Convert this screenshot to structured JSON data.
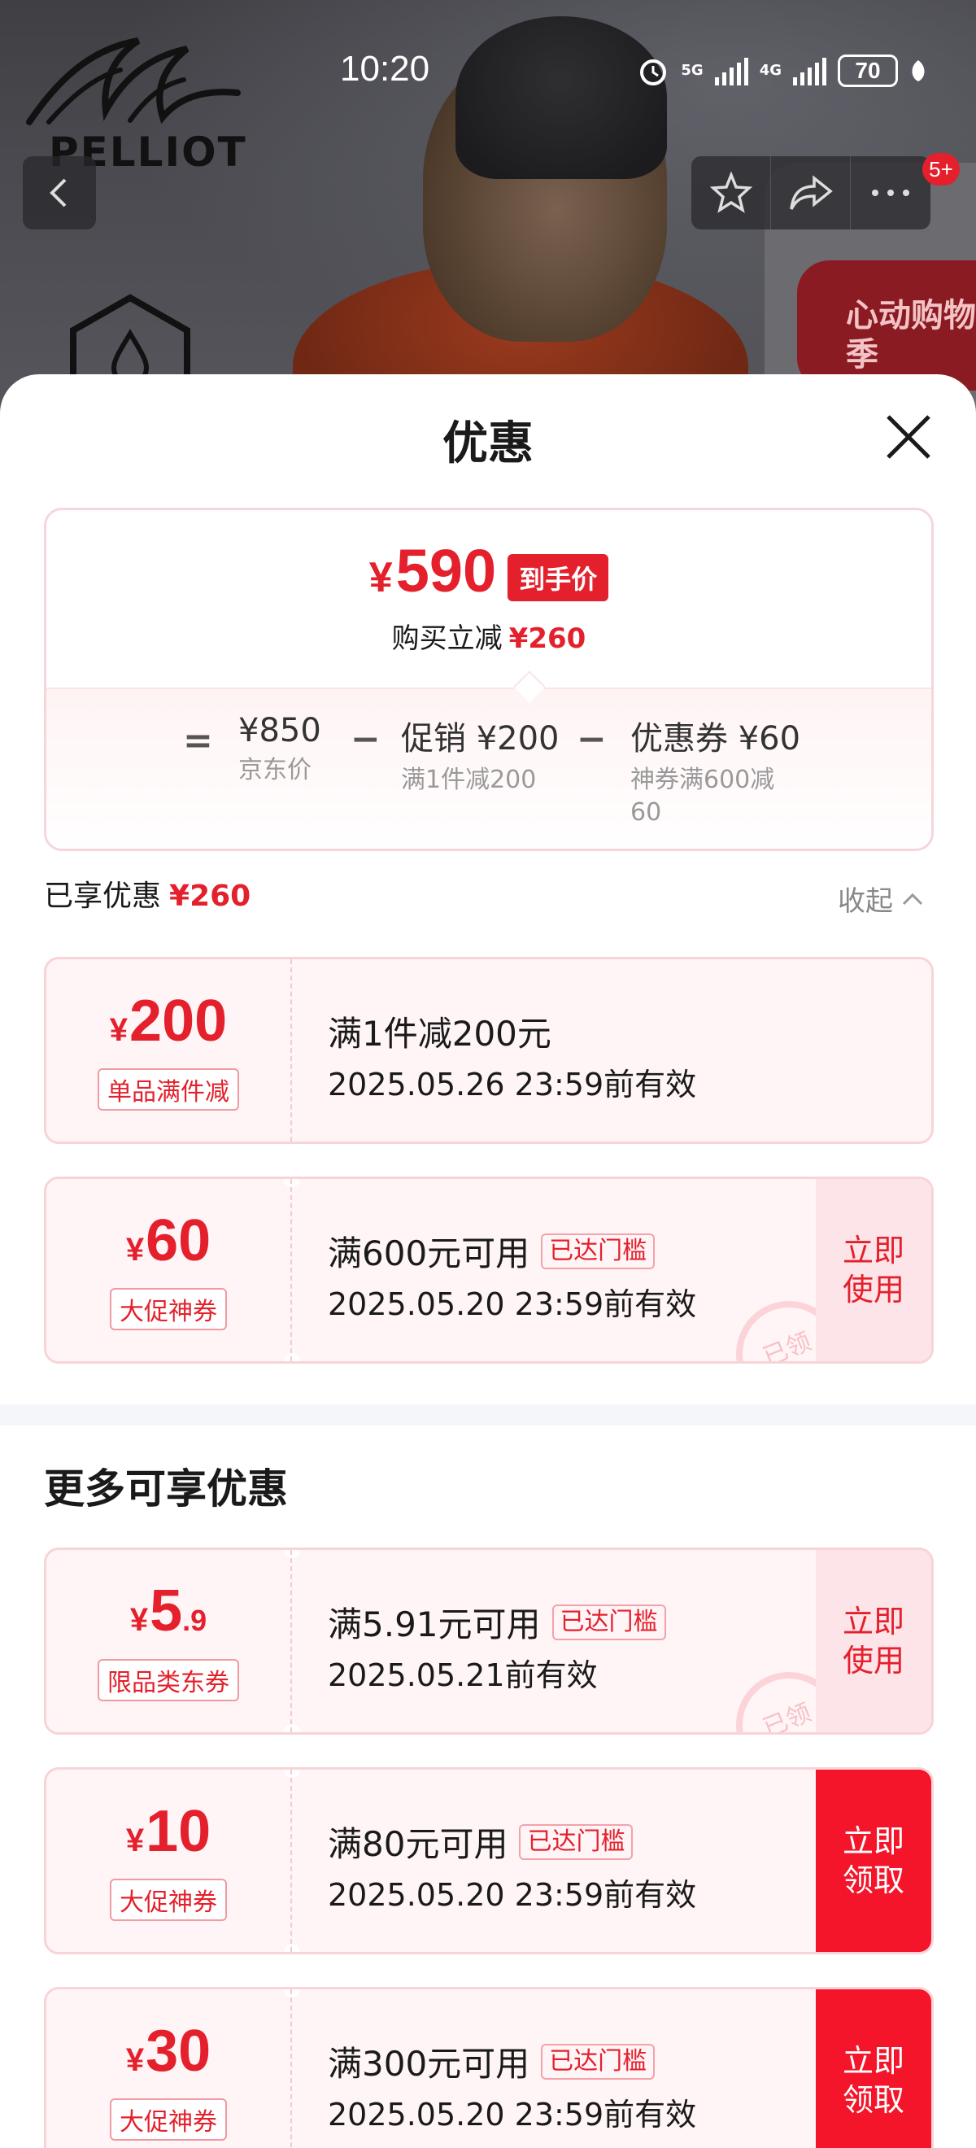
{
  "status": {
    "time": "10:20",
    "net1": "5G",
    "net2": "4G",
    "battery": "70"
  },
  "brand": {
    "logo_text": "PELLIOT"
  },
  "nav": {
    "badge": "5+"
  },
  "hero": {
    "promo": "心动购物季"
  },
  "sheet": {
    "title": "优惠"
  },
  "summary": {
    "final_price": "590",
    "currency": "¥",
    "final_tag": "到手价",
    "reduce_label": "购买立减",
    "reduce_amount": "¥260",
    "equals": "=",
    "minus": "−",
    "jd_price": "¥850",
    "jd_price_label": "京东价",
    "promo_value": "促销 ¥200",
    "promo_sub": "满1件减200",
    "coupon_value": "优惠券 ¥60",
    "coupon_sub_1": "神券满600减",
    "coupon_sub_2": "60"
  },
  "enjoyed": {
    "label": "已享优惠",
    "amount": "¥260",
    "collapse": "收起"
  },
  "applied_coupons": [
    {
      "amount": "200",
      "kind": "单品满件减",
      "condition": "满1件减200元",
      "valid": "2025.05.26 23:59前有效"
    },
    {
      "amount": "60",
      "kind": "大促神券",
      "condition": "满600元可用",
      "reached": "已达门槛",
      "valid": "2025.05.20 23:59前有效",
      "cta": "立即使用",
      "stamp": "已领"
    }
  ],
  "more": {
    "title": "更多可享优惠"
  },
  "more_coupons": [
    {
      "amount": "5",
      "decimal": ".9",
      "kind": "限品类东券",
      "condition": "满5.91元可用",
      "reached": "已达门槛",
      "valid": "2025.05.21前有效",
      "cta": "立即使用",
      "stamp": "已领"
    },
    {
      "amount": "10",
      "kind": "大促神券",
      "condition": "满80元可用",
      "reached": "已达门槛",
      "valid": "2025.05.20 23:59前有效",
      "cta": "立即领取"
    },
    {
      "amount": "30",
      "kind": "大促神券",
      "condition": "满300元可用",
      "reached": "已达门槛",
      "valid": "2025.05.20 23:59前有效",
      "cta": "立即领取"
    }
  ],
  "colors": {
    "accent": "#e4202c",
    "claim": "#f5152a",
    "use_bg": "#fde4e8"
  }
}
